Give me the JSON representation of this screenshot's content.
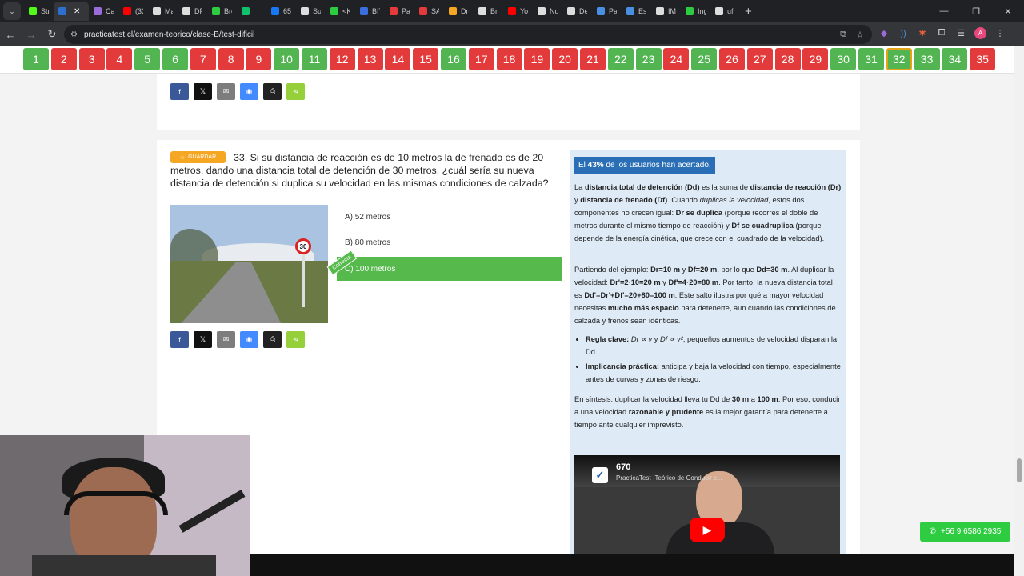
{
  "browser": {
    "tabs": [
      {
        "label": "Strea",
        "color": "#53fc18"
      },
      {
        "label": "",
        "color": "#2d6fd1",
        "active": true
      },
      {
        "label": "Capt",
        "color": "#9b6bdc"
      },
      {
        "label": "(337",
        "color": "#ff0000"
      },
      {
        "label": "Mar",
        "color": "#ddd"
      },
      {
        "label": "DPS",
        "color": "#ddd"
      },
      {
        "label": "Brea",
        "color": "#2ecc40"
      },
      {
        "label": "",
        "color": "#11c26d"
      },
      {
        "label": "654",
        "color": "#1877f2"
      },
      {
        "label": "Sum",
        "color": "#ddd"
      },
      {
        "label": "<KF",
        "color": "#2ecc40"
      },
      {
        "label": "BITC",
        "color": "#3a6fe0"
      },
      {
        "label": "Patc",
        "color": "#e33b3b"
      },
      {
        "label": "SAN",
        "color": "#e33b3b"
      },
      {
        "label": "Drop",
        "color": "#f5a623"
      },
      {
        "label": "Brea",
        "color": "#ddd"
      },
      {
        "label": "You",
        "color": "#ff0000"
      },
      {
        "label": "Nue",
        "color": "#ddd"
      },
      {
        "label": "Deta",
        "color": "#ddd"
      },
      {
        "label": "Pag",
        "color": "#4a90e2"
      },
      {
        "label": "Essl",
        "color": "#4a90e2"
      },
      {
        "label": "IMG",
        "color": "#ddd"
      },
      {
        "label": "Inge",
        "color": "#2ecc40"
      },
      {
        "label": "uf a",
        "color": "#ddd"
      }
    ],
    "url": "practicatest.cl/examen-teorico/clase-B/test-dificil"
  },
  "question_nav": {
    "buttons": [
      {
        "n": "1",
        "status": "ok"
      },
      {
        "n": "2",
        "status": "bad"
      },
      {
        "n": "3",
        "status": "bad"
      },
      {
        "n": "4",
        "status": "bad"
      },
      {
        "n": "5",
        "status": "ok"
      },
      {
        "n": "6",
        "status": "ok"
      },
      {
        "n": "7",
        "status": "bad"
      },
      {
        "n": "8",
        "status": "bad"
      },
      {
        "n": "9",
        "status": "bad"
      },
      {
        "n": "10",
        "status": "ok"
      },
      {
        "n": "11",
        "status": "ok"
      },
      {
        "n": "12",
        "status": "bad"
      },
      {
        "n": "13",
        "status": "bad"
      },
      {
        "n": "14",
        "status": "bad"
      },
      {
        "n": "15",
        "status": "bad"
      },
      {
        "n": "16",
        "status": "ok"
      },
      {
        "n": "17",
        "status": "bad"
      },
      {
        "n": "18",
        "status": "bad"
      },
      {
        "n": "19",
        "status": "bad"
      },
      {
        "n": "20",
        "status": "bad"
      },
      {
        "n": "21",
        "status": "bad"
      },
      {
        "n": "22",
        "status": "ok"
      },
      {
        "n": "23",
        "status": "ok"
      },
      {
        "n": "24",
        "status": "bad"
      },
      {
        "n": "25",
        "status": "ok"
      },
      {
        "n": "26",
        "status": "bad"
      },
      {
        "n": "27",
        "status": "bad"
      },
      {
        "n": "28",
        "status": "bad"
      },
      {
        "n": "29",
        "status": "bad"
      },
      {
        "n": "30",
        "status": "ok"
      },
      {
        "n": "31",
        "status": "ok"
      },
      {
        "n": "32",
        "status": "ok",
        "current": true
      },
      {
        "n": "33",
        "status": "ok"
      },
      {
        "n": "34",
        "status": "ok"
      },
      {
        "n": "35",
        "status": "bad"
      }
    ]
  },
  "question": {
    "save_label": "GUARDAR",
    "text": "33. Si su distancia de reacción es de 10 metros la de frenado es de 20 metros, dando una distancia total de detención de 30 metros, ¿cuál sería su nueva distancia de detención si duplica su velocidad en las mismas condiciones de calzada?",
    "sign_value": "30",
    "options": [
      "A) 52 metros",
      "B) 80 metros",
      "C) 100 metros"
    ],
    "correct_tag": "Correcta"
  },
  "explanation": {
    "pct": "43%",
    "pct_suffix": " de los usuarios han acertado."
  },
  "video": {
    "count": "670",
    "title": "PracticaTest -Teórico de Conducir c..."
  },
  "whatsapp": "+56 9 6586 2935"
}
